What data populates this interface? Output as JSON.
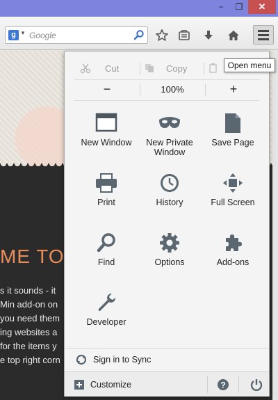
{
  "window": {
    "minimize": "−",
    "maximize": "❐",
    "close": "✕"
  },
  "toolbar": {
    "search_engine_letter": "g",
    "search_placeholder": "Google",
    "icons": [
      "star-icon",
      "reading-list-icon",
      "download-icon",
      "home-icon",
      "hamburger-menu-icon"
    ]
  },
  "tooltip": {
    "text": "Open menu"
  },
  "background": {
    "headline": "ME TO",
    "lines": [
      "s it sounds - it",
      "Min add-on on",
      "you need them",
      "ing websites a",
      " for the items y",
      "e top right corn"
    ]
  },
  "menu": {
    "edit": {
      "cut": "Cut",
      "copy": "Copy"
    },
    "zoom": {
      "minus": "−",
      "level": "100%",
      "plus": "+"
    },
    "items": [
      {
        "label": "New Window",
        "icon": "new-window-icon"
      },
      {
        "label": "New Private Window",
        "icon": "private-mask-icon"
      },
      {
        "label": "Save Page",
        "icon": "save-page-icon"
      },
      {
        "label": "Print",
        "icon": "print-icon"
      },
      {
        "label": "History",
        "icon": "history-clock-icon"
      },
      {
        "label": "Full Screen",
        "icon": "full-screen-icon"
      },
      {
        "label": "Find",
        "icon": "find-magnifier-icon"
      },
      {
        "label": "Options",
        "icon": "options-gear-icon"
      },
      {
        "label": "Add-ons",
        "icon": "add-ons-puzzle-icon"
      },
      {
        "label": "Developer",
        "icon": "developer-wrench-icon"
      }
    ],
    "sync": "Sign in to Sync",
    "customize": "Customize"
  },
  "colors": {
    "titlebar": "#7e84de",
    "close": "#c75050",
    "accent_text": "#e98d5a",
    "icon_gray": "#5a6670"
  }
}
